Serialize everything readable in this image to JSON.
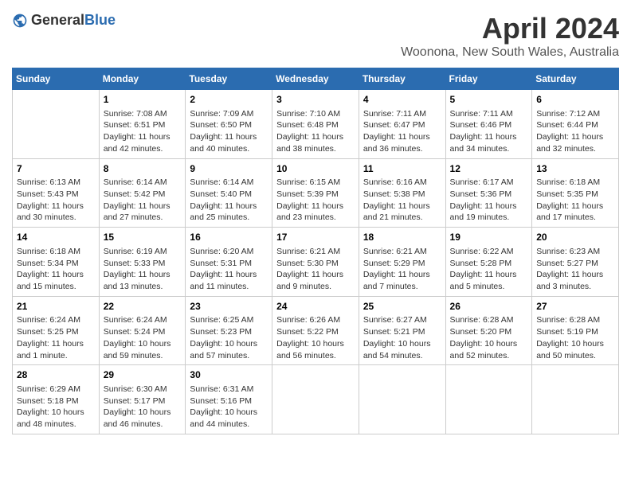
{
  "header": {
    "logo_general": "General",
    "logo_blue": "Blue",
    "month": "April 2024",
    "location": "Woonona, New South Wales, Australia"
  },
  "calendar": {
    "weekdays": [
      "Sunday",
      "Monday",
      "Tuesday",
      "Wednesday",
      "Thursday",
      "Friday",
      "Saturday"
    ],
    "weeks": [
      [
        {
          "day": "",
          "info": ""
        },
        {
          "day": "1",
          "info": "Sunrise: 7:08 AM\nSunset: 6:51 PM\nDaylight: 11 hours\nand 42 minutes."
        },
        {
          "day": "2",
          "info": "Sunrise: 7:09 AM\nSunset: 6:50 PM\nDaylight: 11 hours\nand 40 minutes."
        },
        {
          "day": "3",
          "info": "Sunrise: 7:10 AM\nSunset: 6:48 PM\nDaylight: 11 hours\nand 38 minutes."
        },
        {
          "day": "4",
          "info": "Sunrise: 7:11 AM\nSunset: 6:47 PM\nDaylight: 11 hours\nand 36 minutes."
        },
        {
          "day": "5",
          "info": "Sunrise: 7:11 AM\nSunset: 6:46 PM\nDaylight: 11 hours\nand 34 minutes."
        },
        {
          "day": "6",
          "info": "Sunrise: 7:12 AM\nSunset: 6:44 PM\nDaylight: 11 hours\nand 32 minutes."
        }
      ],
      [
        {
          "day": "7",
          "info": "Sunrise: 6:13 AM\nSunset: 5:43 PM\nDaylight: 11 hours\nand 30 minutes."
        },
        {
          "day": "8",
          "info": "Sunrise: 6:14 AM\nSunset: 5:42 PM\nDaylight: 11 hours\nand 27 minutes."
        },
        {
          "day": "9",
          "info": "Sunrise: 6:14 AM\nSunset: 5:40 PM\nDaylight: 11 hours\nand 25 minutes."
        },
        {
          "day": "10",
          "info": "Sunrise: 6:15 AM\nSunset: 5:39 PM\nDaylight: 11 hours\nand 23 minutes."
        },
        {
          "day": "11",
          "info": "Sunrise: 6:16 AM\nSunset: 5:38 PM\nDaylight: 11 hours\nand 21 minutes."
        },
        {
          "day": "12",
          "info": "Sunrise: 6:17 AM\nSunset: 5:36 PM\nDaylight: 11 hours\nand 19 minutes."
        },
        {
          "day": "13",
          "info": "Sunrise: 6:18 AM\nSunset: 5:35 PM\nDaylight: 11 hours\nand 17 minutes."
        }
      ],
      [
        {
          "day": "14",
          "info": "Sunrise: 6:18 AM\nSunset: 5:34 PM\nDaylight: 11 hours\nand 15 minutes."
        },
        {
          "day": "15",
          "info": "Sunrise: 6:19 AM\nSunset: 5:33 PM\nDaylight: 11 hours\nand 13 minutes."
        },
        {
          "day": "16",
          "info": "Sunrise: 6:20 AM\nSunset: 5:31 PM\nDaylight: 11 hours\nand 11 minutes."
        },
        {
          "day": "17",
          "info": "Sunrise: 6:21 AM\nSunset: 5:30 PM\nDaylight: 11 hours\nand 9 minutes."
        },
        {
          "day": "18",
          "info": "Sunrise: 6:21 AM\nSunset: 5:29 PM\nDaylight: 11 hours\nand 7 minutes."
        },
        {
          "day": "19",
          "info": "Sunrise: 6:22 AM\nSunset: 5:28 PM\nDaylight: 11 hours\nand 5 minutes."
        },
        {
          "day": "20",
          "info": "Sunrise: 6:23 AM\nSunset: 5:27 PM\nDaylight: 11 hours\nand 3 minutes."
        }
      ],
      [
        {
          "day": "21",
          "info": "Sunrise: 6:24 AM\nSunset: 5:25 PM\nDaylight: 11 hours\nand 1 minute."
        },
        {
          "day": "22",
          "info": "Sunrise: 6:24 AM\nSunset: 5:24 PM\nDaylight: 10 hours\nand 59 minutes."
        },
        {
          "day": "23",
          "info": "Sunrise: 6:25 AM\nSunset: 5:23 PM\nDaylight: 10 hours\nand 57 minutes."
        },
        {
          "day": "24",
          "info": "Sunrise: 6:26 AM\nSunset: 5:22 PM\nDaylight: 10 hours\nand 56 minutes."
        },
        {
          "day": "25",
          "info": "Sunrise: 6:27 AM\nSunset: 5:21 PM\nDaylight: 10 hours\nand 54 minutes."
        },
        {
          "day": "26",
          "info": "Sunrise: 6:28 AM\nSunset: 5:20 PM\nDaylight: 10 hours\nand 52 minutes."
        },
        {
          "day": "27",
          "info": "Sunrise: 6:28 AM\nSunset: 5:19 PM\nDaylight: 10 hours\nand 50 minutes."
        }
      ],
      [
        {
          "day": "28",
          "info": "Sunrise: 6:29 AM\nSunset: 5:18 PM\nDaylight: 10 hours\nand 48 minutes."
        },
        {
          "day": "29",
          "info": "Sunrise: 6:30 AM\nSunset: 5:17 PM\nDaylight: 10 hours\nand 46 minutes."
        },
        {
          "day": "30",
          "info": "Sunrise: 6:31 AM\nSunset: 5:16 PM\nDaylight: 10 hours\nand 44 minutes."
        },
        {
          "day": "",
          "info": ""
        },
        {
          "day": "",
          "info": ""
        },
        {
          "day": "",
          "info": ""
        },
        {
          "day": "",
          "info": ""
        }
      ]
    ]
  }
}
